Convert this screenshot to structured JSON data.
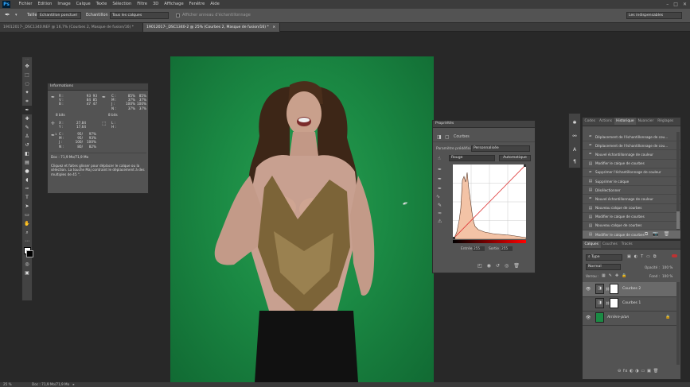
{
  "app": {
    "logo": "Ps"
  },
  "menu": [
    "Fichier",
    "Edition",
    "Image",
    "Calque",
    "Texte",
    "Sélection",
    "Filtre",
    "3D",
    "Affichage",
    "Fenêtre",
    "Aide"
  ],
  "window_controls": {
    "minimize": "–",
    "maximize": "□",
    "close": "✕"
  },
  "options": {
    "size_label": "Taille :",
    "size_value": "Echantillon ponctuel",
    "sample_label": "Echantillon :",
    "sample_value": "Tous les calques",
    "ring_label": "Afficher anneau d'échantillonnage",
    "workspace": "Les indispensables"
  },
  "tabs": [
    {
      "label": "19012017-_DSC1340.NEF @ 16,7% (Courbes 2, Masque de fusion/16) *",
      "active": false
    },
    {
      "label": "19012017-_DSC1340-2 @ 25% (Courbes 2, Masque de fusion/16) *",
      "active": true
    }
  ],
  "tab_close": "×",
  "info_panel": {
    "title": "Informations",
    "r_lbl": "R :",
    "v_lbl": "V :",
    "b_lbl": "B :",
    "r1": "93",
    "r2": "93",
    "v1": "84",
    "v2": "85",
    "b1": "47",
    "b2": "47",
    "c_lbl": "C :",
    "m_lbl": "M :",
    "j_lbl": "J :",
    "n_lbl": "N :",
    "c1": "85%",
    "c2": "85%",
    "m1": "37%",
    "m2": "37%",
    "j1": "100%",
    "j2": "100%",
    "n1": "37%",
    "n2": "37%",
    "bits8": "8 bits",
    "bits16": "8 bits",
    "x_lbl": "X :",
    "y_lbl": "Y :",
    "x": "27,84",
    "y": "17,64",
    "l_lbl": "L :",
    "h_lbl": "H :",
    "c3": "95/",
    "c4": "97%",
    "m3": "95/",
    "m4": "93%",
    "j3": "100/",
    "j4": "100%",
    "n3": "80/",
    "n4": "82%",
    "doc": "Doc : 71,9 Mo/71,9 Mo",
    "help": "Cliquez et faites glisser pour déplacer le calque ou la sélection. La touche Maj contraint le déplacement à des multiples de 45 °."
  },
  "properties": {
    "title": "Propriétés",
    "subtitle": "Courbes",
    "preset_label": "Paramètre prédéfini :",
    "preset_value": "Personnalisée",
    "channel": "Rouge",
    "auto_button": "Automatique",
    "input_label": "Entrée :",
    "input_value": "255",
    "output_label": "Sortie :",
    "output_value": "255"
  },
  "history_panel": {
    "tabs": [
      "Codes",
      "Actions",
      "Historique",
      "Nuancier",
      "Réglages"
    ],
    "active_tab": "Historique",
    "items": [
      "Déplacement de l'échantillonnage de cou...",
      "Déplacement de l'échantillonnage de cou...",
      "Nouvel échantillonnage de couleur",
      "Modifier le calque de courbes",
      "Supprimer l'échantillonnage de couleur",
      "Supprimer le calque",
      "Désélectionner",
      "Nouvel échantillonnage de couleur",
      "Nouveau calque de courbes",
      "Modifier le calque de courbes",
      "Nouveau calque de courbes",
      "Modifier le calque de courbes"
    ],
    "selected_index": 11
  },
  "layers_panel": {
    "tabs": [
      "Calques",
      "Couches",
      "Tracés"
    ],
    "active_tab": "Calques",
    "filter_kind": "Type",
    "blend_mode": "Normal",
    "opacity_label": "Opacité :",
    "opacity_value": "100 %",
    "lock_label": "Verrou :",
    "fill_label": "Fond :",
    "fill_value": "100 %",
    "layers": [
      {
        "name": "Courbes 2",
        "visible": true,
        "selected": true
      },
      {
        "name": "Courbes 1",
        "visible": false,
        "selected": false
      },
      {
        "name": "Arrière-plan",
        "visible": true,
        "selected": false
      }
    ],
    "footer_icons": "⊖  fx  ◐  ◑  ▭  ▣  🗑"
  },
  "status": {
    "doc": "Doc : 71,9 Mo/71,9 Mo"
  },
  "colors": {
    "accent_green": "#1b8a44",
    "panel": "#535353",
    "dark": "#282828"
  }
}
